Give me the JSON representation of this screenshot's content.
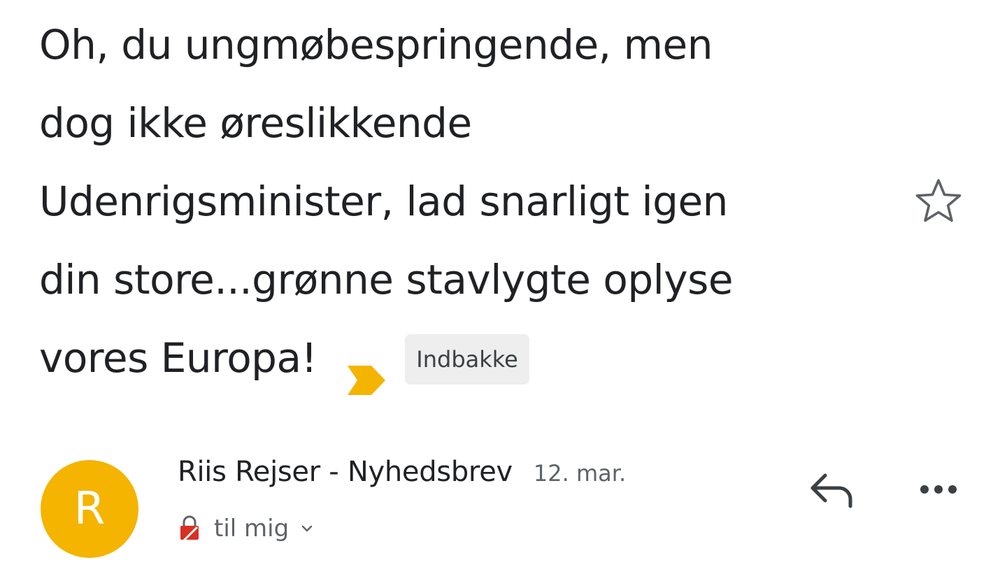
{
  "email": {
    "subject_lines": [
      "Oh, du ungmøbespringende, men",
      "dog ikke øreslikkende",
      "Udenrigsminister, lad snarligt igen",
      "din store...grønne stavlygte oplyse",
      "vores Europa!"
    ],
    "label_chip": "Indbakke",
    "important_marker": "importance-marker-icon",
    "star": "star-outline-icon",
    "sender": {
      "avatar_letter": "R",
      "avatar_color": "#f4b400",
      "name": "Riis Rejser - Nyhedsbrev",
      "date": "12. mar.",
      "recipient_label": "til mig"
    },
    "actions": {
      "reply": "reply-icon",
      "more": "more-horizontal-icon"
    }
  },
  "colors": {
    "text_primary": "#202124",
    "text_secondary": "#5f6368",
    "chip_background": "#eeeeee",
    "importance_marker": "#f4b400",
    "lock_icon": "#d93025"
  }
}
